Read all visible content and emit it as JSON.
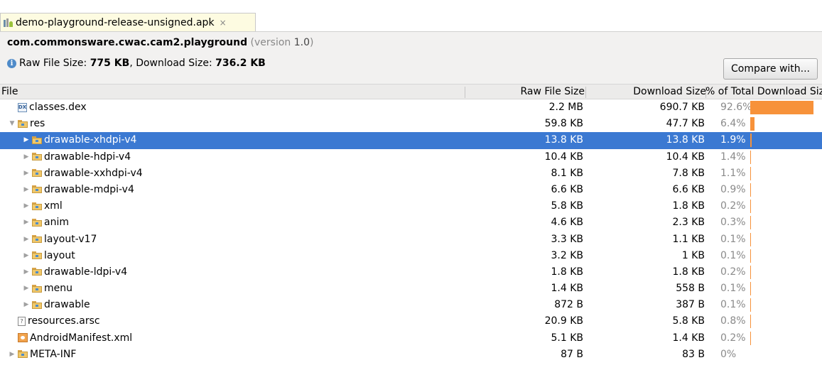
{
  "tab": {
    "title": "demo-playground-release-unsigned.apk",
    "close": "×"
  },
  "header": {
    "package": "com.commonsware.cwac.cam2.playground",
    "version_prefix": "(version ",
    "version": "1.0",
    "version_suffix": ")",
    "raw_label": "Raw File Size: ",
    "raw_value": "775 KB",
    "dl_label": ", Download Size: ",
    "dl_value": "736.2 KB",
    "compare_label": "Compare with..."
  },
  "columns": {
    "file": "File",
    "raw": "Raw File Size",
    "download": "Download Size",
    "percent": "% of Total Download Size"
  },
  "rows": [
    {
      "name": "classes.dex",
      "raw": "2.2 MB",
      "download": "690.7 KB",
      "percent": "92.6%",
      "pct": 92.6,
      "icon": "dex-icon",
      "depth": 0,
      "arrow": "",
      "selected": false
    },
    {
      "name": "res",
      "raw": "59.8 KB",
      "download": "47.7 KB",
      "percent": "6.4%",
      "pct": 6.4,
      "icon": "folder-icon",
      "depth": 0,
      "arrow": "▼",
      "selected": false
    },
    {
      "name": "drawable-xhdpi-v4",
      "raw": "13.8 KB",
      "download": "13.8 KB",
      "percent": "1.9%",
      "pct": 1.9,
      "icon": "folder-icon",
      "depth": 1,
      "arrow": "▶",
      "selected": true
    },
    {
      "name": "drawable-hdpi-v4",
      "raw": "10.4 KB",
      "download": "10.4 KB",
      "percent": "1.4%",
      "pct": 1.4,
      "icon": "folder-icon",
      "depth": 1,
      "arrow": "▶",
      "selected": false
    },
    {
      "name": "drawable-xxhdpi-v4",
      "raw": "8.1 KB",
      "download": "7.8 KB",
      "percent": "1.1%",
      "pct": 1.1,
      "icon": "folder-icon",
      "depth": 1,
      "arrow": "▶",
      "selected": false
    },
    {
      "name": "drawable-mdpi-v4",
      "raw": "6.6 KB",
      "download": "6.6 KB",
      "percent": "0.9%",
      "pct": 0.9,
      "icon": "folder-icon",
      "depth": 1,
      "arrow": "▶",
      "selected": false
    },
    {
      "name": "xml",
      "raw": "5.8 KB",
      "download": "1.8 KB",
      "percent": "0.2%",
      "pct": 0.2,
      "icon": "folder-icon",
      "depth": 1,
      "arrow": "▶",
      "selected": false
    },
    {
      "name": "anim",
      "raw": "4.6 KB",
      "download": "2.3 KB",
      "percent": "0.3%",
      "pct": 0.3,
      "icon": "folder-icon",
      "depth": 1,
      "arrow": "▶",
      "selected": false
    },
    {
      "name": "layout-v17",
      "raw": "3.3 KB",
      "download": "1.1 KB",
      "percent": "0.1%",
      "pct": 0.1,
      "icon": "folder-icon",
      "depth": 1,
      "arrow": "▶",
      "selected": false
    },
    {
      "name": "layout",
      "raw": "3.2 KB",
      "download": "1 KB",
      "percent": "0.1%",
      "pct": 0.1,
      "icon": "folder-icon",
      "depth": 1,
      "arrow": "▶",
      "selected": false
    },
    {
      "name": "drawable-ldpi-v4",
      "raw": "1.8 KB",
      "download": "1.8 KB",
      "percent": "0.2%",
      "pct": 0.2,
      "icon": "folder-icon",
      "depth": 1,
      "arrow": "▶",
      "selected": false
    },
    {
      "name": "menu",
      "raw": "1.4 KB",
      "download": "558 B",
      "percent": "0.1%",
      "pct": 0.1,
      "icon": "folder-icon",
      "depth": 1,
      "arrow": "▶",
      "selected": false
    },
    {
      "name": "drawable",
      "raw": "872 B",
      "download": "387 B",
      "percent": "0.1%",
      "pct": 0.1,
      "icon": "folder-icon",
      "depth": 1,
      "arrow": "▶",
      "selected": false
    },
    {
      "name": "resources.arsc",
      "raw": "20.9 KB",
      "download": "5.8 KB",
      "percent": "0.8%",
      "pct": 0.8,
      "icon": "arsc-icon",
      "depth": 0,
      "arrow": "",
      "selected": false
    },
    {
      "name": "AndroidManifest.xml",
      "raw": "5.1 KB",
      "download": "1.4 KB",
      "percent": "0.2%",
      "pct": 0.2,
      "icon": "manifest-icon",
      "depth": 0,
      "arrow": "",
      "selected": false
    },
    {
      "name": "META-INF",
      "raw": "87 B",
      "download": "83 B",
      "percent": "0%",
      "pct": 0,
      "icon": "folder-icon",
      "depth": 0,
      "arrow": "▶",
      "selected": false
    }
  ],
  "colors": {
    "bar": "#f7923a",
    "selection": "#3b79d2",
    "tab_bg": "#fdfbe1"
  }
}
